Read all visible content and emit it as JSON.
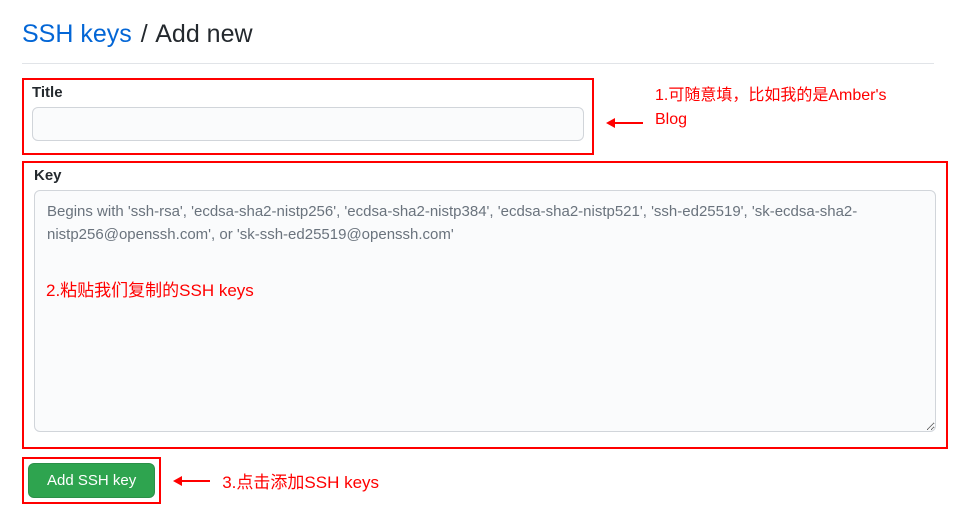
{
  "title": {
    "link_text": "SSH keys",
    "separator": "/",
    "current": "Add new"
  },
  "fields": {
    "title_label": "Title",
    "title_value": "",
    "key_label": "Key",
    "key_value": "",
    "key_placeholder": "Begins with 'ssh-rsa', 'ecdsa-sha2-nistp256', 'ecdsa-sha2-nistp384', 'ecdsa-sha2-nistp521', 'ssh-ed25519', 'sk-ecdsa-sha2-nistp256@openssh.com', or 'sk-ssh-ed25519@openssh.com'"
  },
  "button": {
    "add_label": "Add SSH key"
  },
  "annotations": {
    "note1": "1.可随意填，比如我的是Amber's Blog",
    "note2": "2.粘贴我们复制的SSH keys",
    "note3": "3.点击添加SSH keys"
  },
  "colors": {
    "annotation": "#f00",
    "link": "#0366d6",
    "button_bg": "#2ea44f"
  }
}
